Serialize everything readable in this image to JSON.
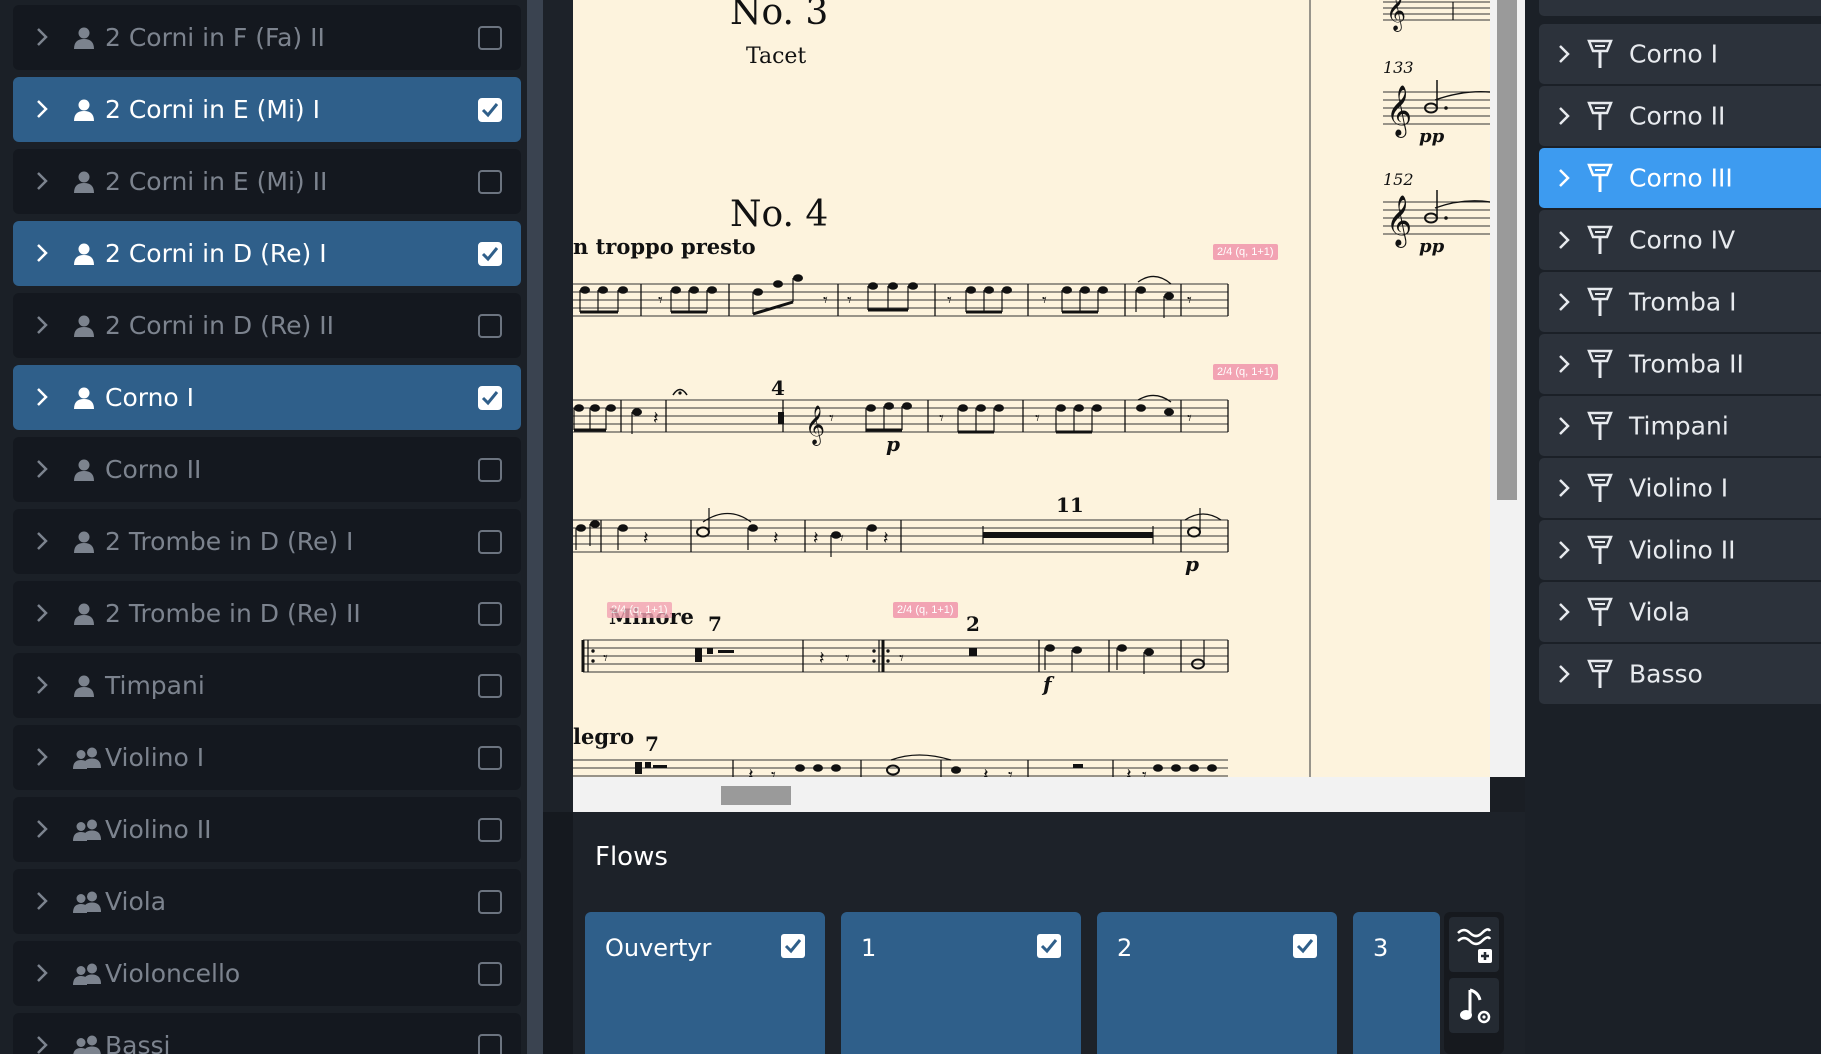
{
  "left_panel": {
    "players": [
      {
        "label": "2 Corni in F (Fa) II",
        "checked": false,
        "type": "single"
      },
      {
        "label": "2 Corni in E (Mi) I",
        "checked": true,
        "type": "single"
      },
      {
        "label": "2 Corni in E (Mi) II",
        "checked": false,
        "type": "single"
      },
      {
        "label": "2 Corni in D (Re) I",
        "checked": true,
        "type": "single"
      },
      {
        "label": "2 Corni in D (Re) II",
        "checked": false,
        "type": "single"
      },
      {
        "label": "Corno I",
        "checked": true,
        "type": "single"
      },
      {
        "label": "Corno II",
        "checked": false,
        "type": "single"
      },
      {
        "label": "2 Trombe in D (Re) I",
        "checked": false,
        "type": "single"
      },
      {
        "label": "2 Trombe in D (Re) II",
        "checked": false,
        "type": "single"
      },
      {
        "label": "Timpani",
        "checked": false,
        "type": "single"
      },
      {
        "label": "Violino I",
        "checked": false,
        "type": "section"
      },
      {
        "label": "Violino II",
        "checked": false,
        "type": "section"
      },
      {
        "label": "Viola",
        "checked": false,
        "type": "section"
      },
      {
        "label": "Violoncello",
        "checked": false,
        "type": "section"
      },
      {
        "label": "Bassi",
        "checked": false,
        "type": "section"
      }
    ]
  },
  "score": {
    "no3_title": "No. 3",
    "no3_tacet": "Tacet",
    "no4_title": "No. 4",
    "tempo_text": "n troppo presto",
    "minore_text": "Minore",
    "allegro_text": "legro",
    "tag_text": "2/4 (q, 1+1)",
    "measure_numbers": {
      "m133": "133",
      "m152": "152"
    },
    "multirest_counts": {
      "first": "4",
      "second": "11",
      "third": "7",
      "fourth": "2",
      "fifth": "7"
    },
    "dynamics": {
      "p": "p",
      "f": "f",
      "pp": "pp"
    }
  },
  "flows": {
    "title": "Flows",
    "items": [
      {
        "name": "Ouvertyr",
        "checked": true
      },
      {
        "name": "1",
        "checked": true
      },
      {
        "name": "2",
        "checked": true
      },
      {
        "name": "3",
        "checked": true
      }
    ]
  },
  "right_panel": {
    "instruments": [
      {
        "label": "Corno I",
        "selected": false
      },
      {
        "label": "Corno II",
        "selected": false
      },
      {
        "label": "Corno III",
        "selected": true
      },
      {
        "label": "Corno IV",
        "selected": false
      },
      {
        "label": "Tromba I",
        "selected": false
      },
      {
        "label": "Tromba II",
        "selected": false
      },
      {
        "label": "Timpani",
        "selected": false
      },
      {
        "label": "Violino I",
        "selected": false
      },
      {
        "label": "Violino II",
        "selected": false
      },
      {
        "label": "Viola",
        "selected": false
      },
      {
        "label": "Basso",
        "selected": false
      }
    ]
  },
  "colors": {
    "selected_row": "#2f5f8a",
    "right_selected": "#3d9bf0",
    "page_bg": "#fdf3dd",
    "tag_pink": "#f2a3b3"
  }
}
